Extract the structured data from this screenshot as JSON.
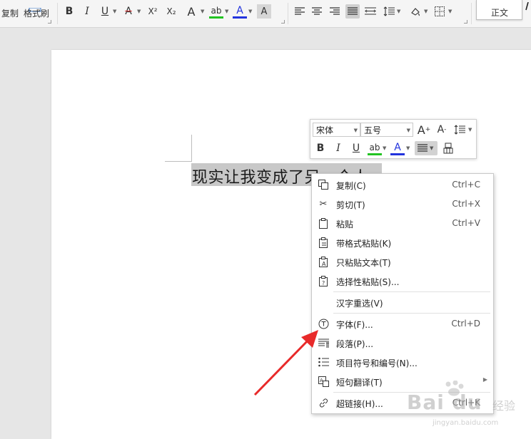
{
  "ribbon": {
    "copy_label": "复制",
    "format_painter_label": "格式刷",
    "style_normal_label": "正文",
    "buttons": {
      "bold": "B",
      "italic": "I",
      "underline": "U",
      "strike": "A",
      "superscript": "X²",
      "subscript": "X₂",
      "text_effect": "A",
      "highlight": "ab",
      "font_color": "A",
      "char_shading": "A"
    }
  },
  "document": {
    "selected_text": "现实让我变成了另一个人"
  },
  "mini_toolbar": {
    "font_name": "宋体",
    "font_size": "五号",
    "bold": "B",
    "italic": "I",
    "underline": "U",
    "highlight": "ab",
    "font_color": "A"
  },
  "context_menu": {
    "items": [
      {
        "label": "复制(C)",
        "shortcut": "Ctrl+C",
        "icon": "copy-icon"
      },
      {
        "label": "剪切(T)",
        "shortcut": "Ctrl+X",
        "icon": "scissors-icon"
      },
      {
        "label": "粘贴",
        "shortcut": "Ctrl+V",
        "icon": "paste-icon"
      },
      {
        "label": "带格式粘贴(K)",
        "shortcut": "",
        "icon": "paste-format-icon"
      },
      {
        "label": "只粘贴文本(T)",
        "shortcut": "",
        "icon": "paste-text-icon"
      },
      {
        "label": "选择性粘贴(S)...",
        "shortcut": "",
        "icon": "paste-special-icon"
      },
      {
        "label": "汉字重选(V)",
        "shortcut": "",
        "icon": ""
      },
      {
        "label": "字体(F)...",
        "shortcut": "Ctrl+D",
        "icon": "font-icon"
      },
      {
        "label": "段落(P)...",
        "shortcut": "",
        "icon": "paragraph-icon"
      },
      {
        "label": "项目符号和编号(N)...",
        "shortcut": "",
        "icon": "bullets-icon"
      },
      {
        "label": "短句翻译(T)",
        "shortcut": "",
        "icon": "translate-icon"
      },
      {
        "label": "超链接(H)...",
        "shortcut": "Ctrl+K",
        "icon": "hyperlink-icon"
      }
    ]
  },
  "watermark": {
    "brand": "Bai du",
    "sub": "经验",
    "url": "jingyan.baidu.com"
  },
  "colors": {
    "highlight_green": "#22c322",
    "font_color_blue": "#2233dd",
    "strike_red": "#e03030",
    "selection_gray": "#c8c8c8",
    "arrow_red": "#e82a2a"
  }
}
